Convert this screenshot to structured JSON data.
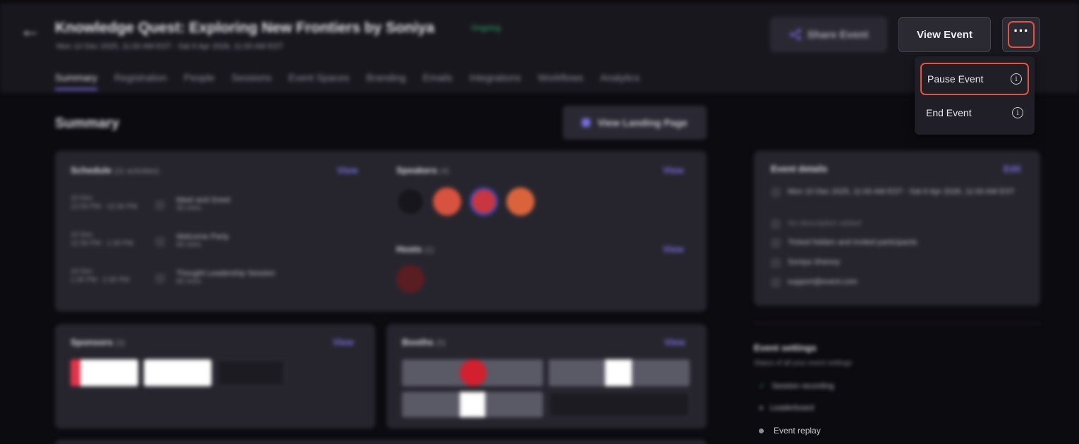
{
  "header": {
    "title": "Knowledge Quest: Exploring New Frontiers by Soniya",
    "status": "Ongoing",
    "dates": "Mon 10 Dec 2025, 11:00 AM EST - Sat 6 Apr 2026, 11:00 AM EST",
    "share_label": "Share Event",
    "view_label": "View Event",
    "more_label": "···"
  },
  "tabs": [
    "Summary",
    "Registration",
    "People",
    "Sessions",
    "Event Spaces",
    "Branding",
    "Emails",
    "Integrations",
    "Workflows",
    "Analytics"
  ],
  "menu": {
    "items": [
      {
        "label": "Pause Event",
        "icon": "info-icon",
        "icon_glyph": "i"
      },
      {
        "label": "End Event",
        "icon": "info-icon",
        "icon_glyph": "i"
      }
    ]
  },
  "summary": {
    "title": "Summary",
    "landing_label": "View Landing Page",
    "schedule": {
      "title": "Schedule",
      "count": "(11 activities)",
      "view": "View",
      "items": [
        {
          "date": "10 Dec",
          "time": "12:00 PM - 12:30 PM",
          "name": "Meet and Greet",
          "sub": "30 mins"
        },
        {
          "date": "10 Dec",
          "time": "12:30 PM - 1:30 PM",
          "name": "Welcome Party",
          "sub": "60 mins"
        },
        {
          "date": "10 Dec",
          "time": "1:30 PM - 2:30 PM",
          "name": "Thought Leadership Session",
          "sub": "60 mins"
        }
      ]
    },
    "speakers": {
      "title": "Speakers",
      "count": "(4)",
      "view": "View"
    },
    "hosts": {
      "title": "Hosts",
      "count": "(1)",
      "view": "View"
    },
    "sponsors": {
      "title": "Sponsors",
      "count": "(3)",
      "view": "View",
      "logos": [
        "twilio",
        "slack"
      ]
    },
    "booths": {
      "title": "Booths",
      "count": "(5)",
      "view": "View"
    }
  },
  "event_details": {
    "title": "Event details",
    "edit": "Edit",
    "dates": "Mon 10 Dec 2025, 11:00 AM EST - Sat 6 Apr 2026, 11:00 AM EST",
    "description": "No description added",
    "participants": "Ticked hidden and invited participants",
    "organizer": "Soniya Shenoy",
    "email": "support@event.com"
  },
  "event_settings": {
    "title": "Event settings",
    "subtitle": "Status of all your event settings",
    "items": [
      "Session recording",
      "Leaderboard",
      "Event replay"
    ]
  },
  "colors": {
    "accent": "#7067d6",
    "highlight": "#e3533f",
    "status": "#2fae64"
  }
}
